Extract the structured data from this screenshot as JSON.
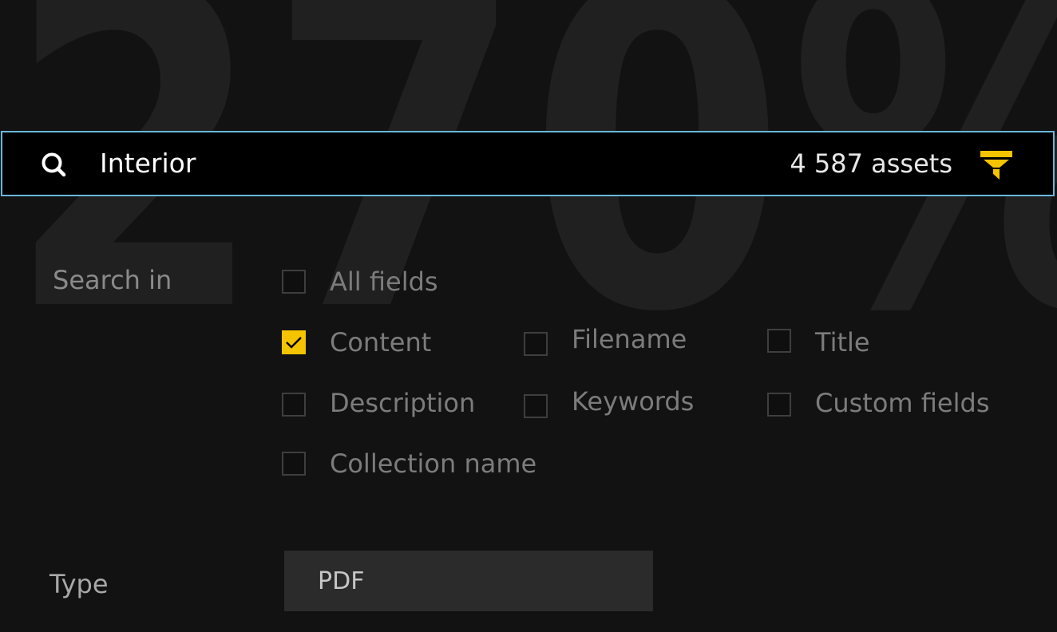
{
  "background": {
    "watermark_text": "270%"
  },
  "search": {
    "query": "Interior",
    "asset_count": "4 587 assets",
    "icons": {
      "search": "search-icon",
      "filter": "filter-icon"
    }
  },
  "search_in": {
    "label": "Search in",
    "options": [
      {
        "label": "All fields",
        "checked": false
      },
      {
        "label": "Content",
        "checked": true
      },
      {
        "label": "Filename",
        "checked": false
      },
      {
        "label": "Title",
        "checked": false
      },
      {
        "label": "Description",
        "checked": false
      },
      {
        "label": "Keywords",
        "checked": false
      },
      {
        "label": "Custom fields",
        "checked": false
      },
      {
        "label": "Collection name",
        "checked": false
      }
    ]
  },
  "type_filter": {
    "label": "Type",
    "selected": "PDF"
  },
  "colors": {
    "accent": "#f5c400",
    "focus_border": "#6ab7dc",
    "background": "#121212",
    "search_bar": "#000000"
  }
}
